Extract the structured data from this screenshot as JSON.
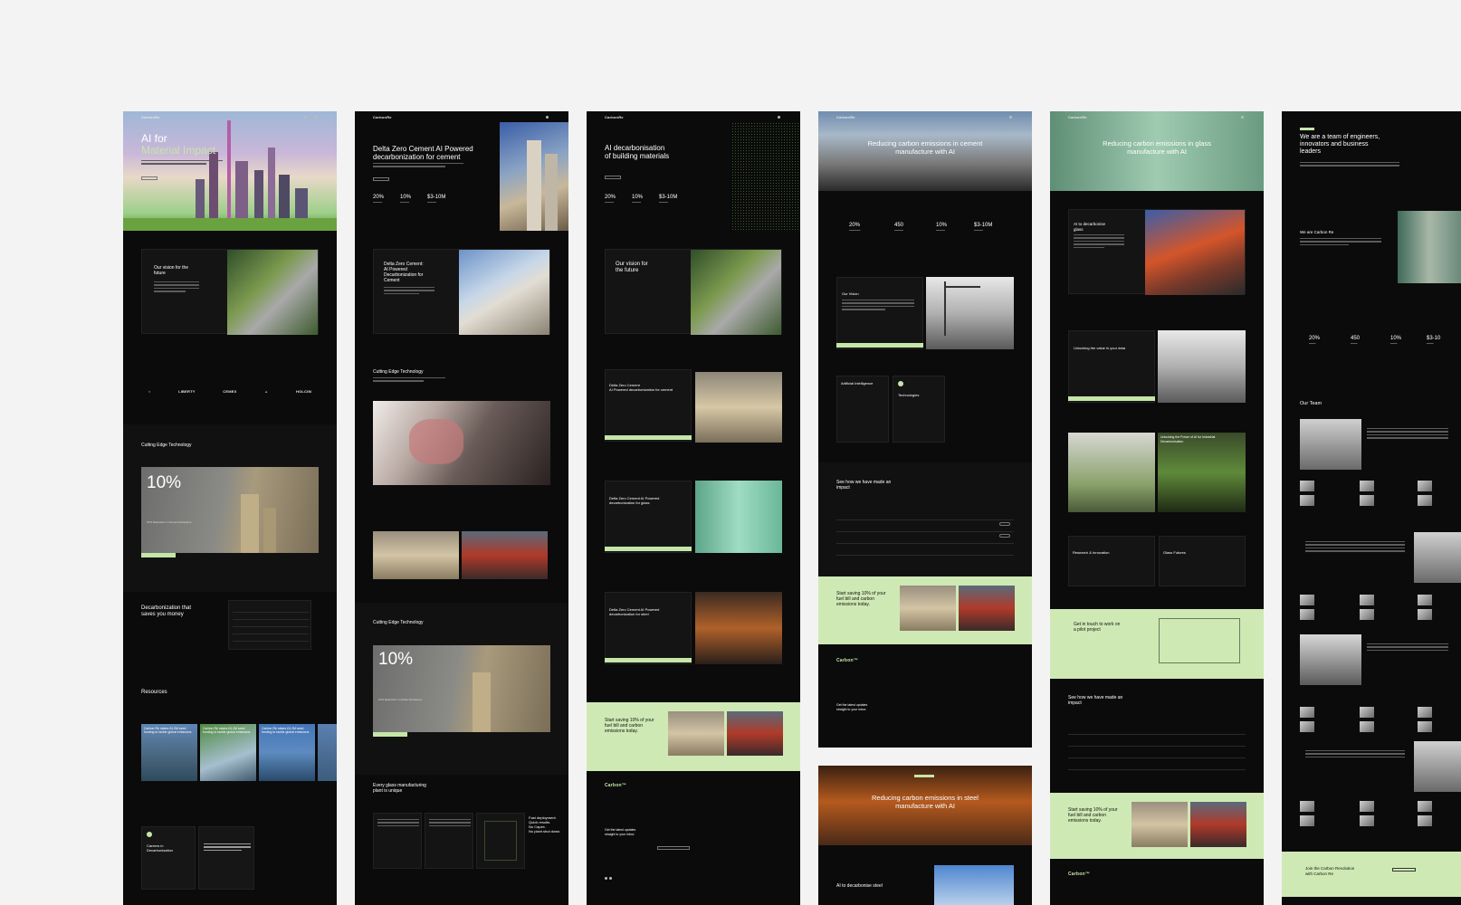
{
  "c1": {
    "brand": "CarbonRe",
    "hero_title_1": "AI for",
    "hero_title_2": "Material Impact",
    "vision_title_1": "Our vision for the",
    "vision_title_2": "future",
    "partners": [
      "LIBERTY",
      "CEMEX",
      "HOLCIM"
    ],
    "tech_title": "Cutting Edge Technology",
    "tech_stat": "10%",
    "tech_caption": "10% Reduction in Cement Emissions",
    "decarb_title_1": "Decarbonization that",
    "decarb_title_2": "saves you money",
    "resources_title": "Resources",
    "resource_cards": [
      "Carbon Re raises £4.2M seed funding to tackle global emissions",
      "Carbon Re raises £4.2M seed funding to tackle global emissions",
      "Carbon Re raises £4.2M seed funding to tackle global emissions"
    ],
    "careers_title_1": "Careers in",
    "careers_title_2": "Decarbonisation"
  },
  "c2": {
    "brand": "CarbonRe",
    "hero_title_1": "Delta Zero Cement AI Powered",
    "hero_title_2": "decarbonization for cement",
    "stats": [
      "20%",
      "10%",
      "$3-10M"
    ],
    "panel_title": [
      "Delta Zero Cement:",
      "AI Powered",
      "Decarbonization for",
      "Cement"
    ],
    "tech_title": "Cutting Edge Technology",
    "tech2_title": "Cutting Edge Technology",
    "tech_stat": "10%",
    "tech_caption": "10% Reduction in Clinker Emissions",
    "glass_title_1": "Every glass manufacturing",
    "glass_title_2": "plant is unique",
    "fast_1": "Fast deployment.",
    "fast_2": "Quick results.",
    "fast_3": "No Capex.",
    "fast_4": "No plant shut down."
  },
  "c3": {
    "brand": "CarbonRe",
    "hero_title_1": "AI decarbonisation",
    "hero_title_2": "of building materials",
    "stats": [
      "20%",
      "10%",
      "$3-10M"
    ],
    "vision_title_1": "Our vision for",
    "vision_title_2": "the future",
    "card1_title_1": "Delta Zero Cement",
    "card1_title_2": "AI Powered decarbonization for cement",
    "card2_title_1": "Delta Zero Cement AI Powered",
    "card2_title_2": "decarbonization for glass",
    "card3_title_1": "Delta Zero Cement AI Powered",
    "card3_title_2": "decarbonization for steel",
    "cta_1": "Start saving 10% of your",
    "cta_2": "fuel bill and carbon",
    "cta_3": "emissions today.",
    "footer_brand": "Carbon™",
    "footer_news_1": "Get the latest updates",
    "footer_news_2": "straight to your inbox"
  },
  "c4": {
    "brand": "CarbonRe",
    "hero_title_1": "Reducing carbon emissions in cement",
    "hero_title_2": "manufacture with AI",
    "stats": [
      "20%",
      "450",
      "10%",
      "$3-10M"
    ],
    "vision_title": "Our Vision",
    "ai_title": "Artificial Intelligence",
    "tech_title": "Technologies",
    "impact_title_1": "See how we have made an",
    "impact_title_2": "impact",
    "cta_1": "Start saving 10% of your",
    "cta_2": "fuel bill and carbon",
    "cta_3": "emissions today.",
    "footer_brand": "Carbon™",
    "footer_news_1": "Get the latest updates",
    "footer_news_2": "straight to your inbox",
    "steel_title_1": "Reducing carbon emissions in steel",
    "steel_title_2": "manufacture with AI",
    "steel_sub": "AI to decarbonise steel"
  },
  "c5": {
    "brand": "CarbonRe",
    "hero_title_1": "Reducing carbon emissions in glass",
    "hero_title_2": "manufacture with AI",
    "ai_title_1": "AI to decarbonise",
    "ai_title_2": "glass",
    "data_title": "Unlocking the value in your data",
    "power_title_1": "Unlocking the Power of AI for Industrial",
    "power_title_2": "Decarbonisation",
    "research_title": "Research & Innovation",
    "futures_title": "Glass Futures",
    "pilot_title_1": "Get in touch to work on",
    "pilot_title_2": "a pilot project",
    "impact_title_1": "See how we have made an",
    "impact_title_2": "impact",
    "cta_1": "Start saving 10% of your",
    "cta_2": "fuel bill and carbon",
    "cta_3": "emissions today.",
    "footer_brand": "Carbon™"
  },
  "c6": {
    "hero_title_1": "We are a team of engineers,",
    "hero_title_2": "innovators and business",
    "hero_title_3": "leaders",
    "about_title": "We are Carbon Re",
    "stats": [
      "20%",
      "450",
      "10%",
      "$3-10"
    ],
    "team_title": "Our Team",
    "join_1": "Join the Carbon Revolution",
    "join_2": "with Carbon Re"
  },
  "colors": {
    "accent_green": "#c6e6a8",
    "bg_dark": "#0b0b0b",
    "canvas": "#f3f3f3"
  }
}
